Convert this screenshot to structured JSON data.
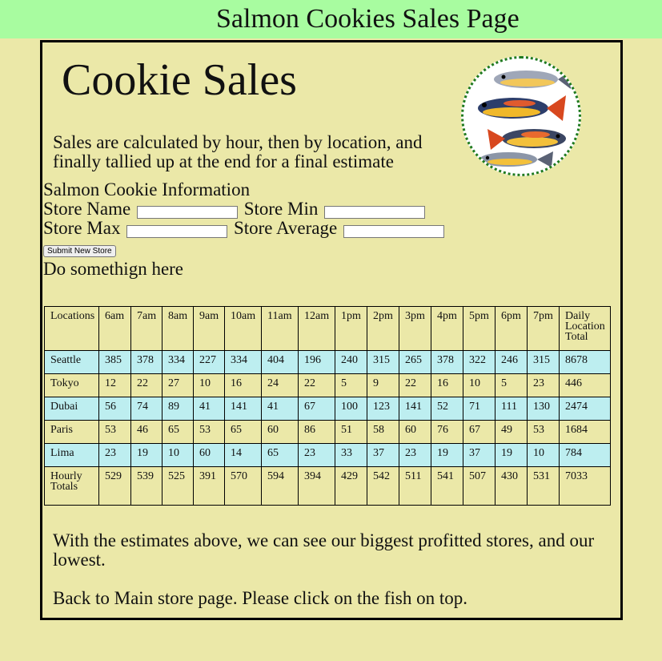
{
  "header": {
    "title": "Salmon Cookies Sales Page"
  },
  "main": {
    "title": "Cookie Sales",
    "intro": "Sales are calculated by hour, then by location, and finally tallied up at the end for a final estimate",
    "logo_icon": "fish-logo-icon"
  },
  "form": {
    "heading": "Salmon Cookie Information",
    "store_name_label": "Store Name",
    "store_min_label": "Store Min",
    "store_max_label": "Store Max",
    "store_avg_label": "Store Average",
    "store_name_value": "",
    "store_min_value": "",
    "store_max_value": "",
    "store_avg_value": "",
    "submit_label": "Submit New Store",
    "placeholder_text": "Do somethign here"
  },
  "table": {
    "headers": [
      "Locations",
      "6am",
      "7am",
      "8am",
      "9am",
      "10am",
      "11am",
      "12am",
      "1pm",
      "2pm",
      "3pm",
      "4pm",
      "5pm",
      "6pm",
      "7pm",
      "Daily Location Total"
    ],
    "rows": [
      [
        "Seattle",
        "385",
        "378",
        "334",
        "227",
        "334",
        "404",
        "196",
        "240",
        "315",
        "265",
        "378",
        "322",
        "246",
        "315",
        "8678"
      ],
      [
        "Tokyo",
        "12",
        "22",
        "27",
        "10",
        "16",
        "24",
        "22",
        "5",
        "9",
        "22",
        "16",
        "10",
        "5",
        "23",
        "446"
      ],
      [
        "Dubai",
        "56",
        "74",
        "89",
        "41",
        "141",
        "41",
        "67",
        "100",
        "123",
        "141",
        "52",
        "71",
        "111",
        "130",
        "2474"
      ],
      [
        "Paris",
        "53",
        "46",
        "65",
        "53",
        "65",
        "60",
        "86",
        "51",
        "58",
        "60",
        "76",
        "67",
        "49",
        "53",
        "1684"
      ],
      [
        "Lima",
        "23",
        "19",
        "10",
        "60",
        "14",
        "65",
        "23",
        "33",
        "37",
        "23",
        "19",
        "37",
        "19",
        "10",
        "784"
      ]
    ],
    "totals": [
      "Hourly Totals",
      "529",
      "539",
      "525",
      "391",
      "570",
      "594",
      "394",
      "429",
      "542",
      "511",
      "541",
      "507",
      "430",
      "531",
      "7033"
    ]
  },
  "footer": {
    "outro": "With the estimates above, we can see our biggest profitted stores, and our lowest.",
    "back_text": "Back to Main store page. Please click on the fish on top."
  },
  "colors": {
    "page_bg": "#ebe8a8",
    "header_bg": "#a8fca0",
    "row_alt": "#bdeef0",
    "logo_border": "#1f7a1f"
  }
}
